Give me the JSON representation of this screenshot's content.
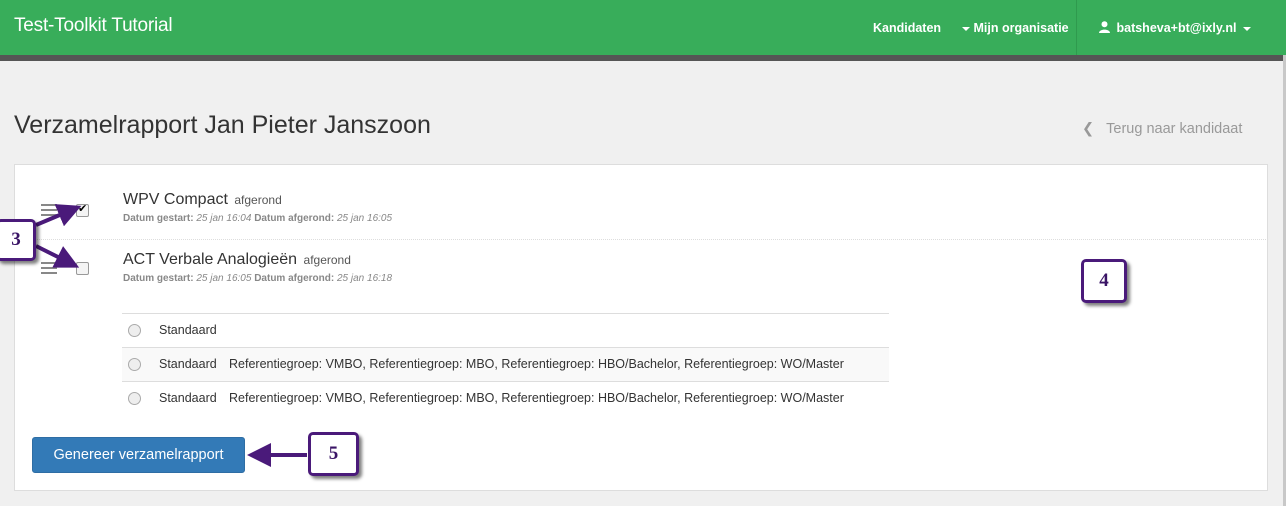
{
  "navbar": {
    "brand": "Test-Toolkit Tutorial",
    "kandidaten": "Kandidaten",
    "organisatie": "Mijn organisatie",
    "user": "batsheva+bt@ixly.nl"
  },
  "page": {
    "title": "Verzamelrapport Jan Pieter Janszoon",
    "back_label": "Terug naar kandidaat"
  },
  "tests": [
    {
      "name": "WPV Compact",
      "status": "afgerond",
      "started_label": "Datum gestart:",
      "started": "25 jan 16:04",
      "finished_label": "Datum afgerond:",
      "finished": "25 jan 16:05",
      "checked": true
    },
    {
      "name": "ACT Verbale Analogieën",
      "status": "afgerond",
      "started_label": "Datum gestart:",
      "started": "25 jan 16:05",
      "finished_label": "Datum afgerond:",
      "finished": "25 jan 16:18",
      "checked": false
    }
  ],
  "report_options": [
    {
      "name": "Standaard",
      "refs": ""
    },
    {
      "name": "Standaard",
      "refs": "Referentiegroep: VMBO, Referentiegroep: MBO, Referentiegroep: HBO/Bachelor, Referentiegroep: WO/Master"
    },
    {
      "name": "Standaard",
      "refs": "Referentiegroep: VMBO, Referentiegroep: MBO, Referentiegroep: HBO/Bachelor, Referentiegroep: WO/Master"
    }
  ],
  "generate_button": "Genereer verzamelrapport",
  "callouts": {
    "c3": "3",
    "c4": "4",
    "c5": "5"
  },
  "colors": {
    "navbar": "#38ad5a",
    "primary_button": "#337ab7",
    "callout_border": "#4a1a7a"
  }
}
